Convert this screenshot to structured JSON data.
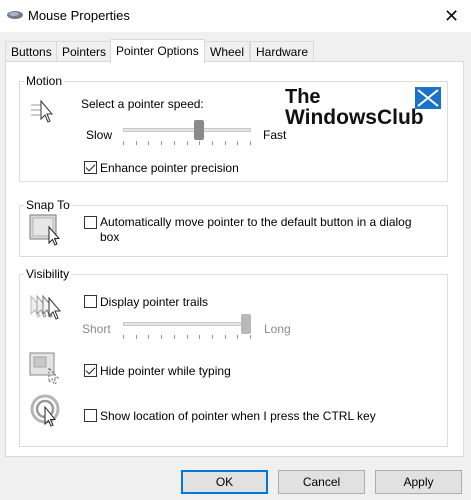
{
  "window": {
    "title": "Mouse Properties",
    "close_glyph": "✕"
  },
  "tabs": [
    {
      "label": "Buttons"
    },
    {
      "label": "Pointers"
    },
    {
      "label": "Pointer Options"
    },
    {
      "label": "Wheel"
    },
    {
      "label": "Hardware"
    }
  ],
  "active_tab": "Pointer Options",
  "motion": {
    "group_label": "Motion",
    "speed_label": "Select a pointer speed:",
    "slow_label": "Slow",
    "fast_label": "Fast",
    "speed_value": 0.6,
    "enhance_label": "Enhance pointer precision",
    "enhance_checked": true
  },
  "snap_to": {
    "group_label": "Snap To",
    "auto_move_label": "Automatically move pointer to the default button in a dialog",
    "auto_move_label_line2": "box",
    "auto_move_checked": false
  },
  "visibility": {
    "group_label": "Visibility",
    "trails_label": "Display pointer trails",
    "trails_checked": false,
    "short_label": "Short",
    "long_label": "Long",
    "trail_length_value": 1.0,
    "hide_typing_label": "Hide pointer while typing",
    "hide_typing_checked": true,
    "show_location_label": "Show location of pointer when I press the CTRL key",
    "show_location_checked": false
  },
  "watermark": {
    "line1": "The",
    "line2": "WindowsClub"
  },
  "buttons": {
    "ok": "OK",
    "cancel": "Cancel",
    "apply": "Apply"
  },
  "colors": {
    "accent": "#0078d7",
    "watermark_blue": "#1a73c8"
  }
}
